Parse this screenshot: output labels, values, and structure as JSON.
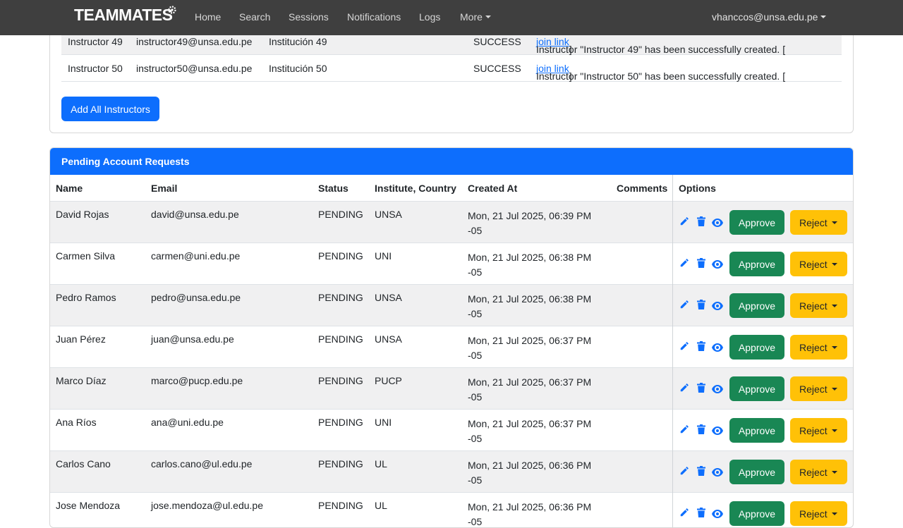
{
  "navbar": {
    "brand": "TEAMMATES",
    "links": [
      "Home",
      "Search",
      "Sessions",
      "Notifications",
      "Logs"
    ],
    "more_label": "More",
    "user_email": "vhanccos@unsa.edu.pe"
  },
  "instructors": {
    "rows": [
      {
        "name": "Instructor 49",
        "email": "instructor49@unsa.edu.pe",
        "institution": "Institución 49",
        "status": "SUCCESS",
        "message": "Instructor \"Instructor 49\" has been successfully created. [",
        "link": "join link",
        "message_end": "]"
      },
      {
        "name": "Instructor 50",
        "email": "instructor50@unsa.edu.pe",
        "institution": "Institución 50",
        "status": "SUCCESS",
        "message": "Instructor \"Instructor 50\" has been successfully created. [",
        "link": "join link",
        "message_end": "]"
      }
    ],
    "add_all_label": "Add All Instructors"
  },
  "pending": {
    "title": "Pending Account Requests",
    "columns": [
      "Name",
      "Email",
      "Status",
      "Institute, Country",
      "Created At",
      "Comments",
      "Options"
    ],
    "approve_label": "Approve",
    "reject_label": "Reject",
    "rows": [
      {
        "name": "David Rojas",
        "email": "david@unsa.edu.pe",
        "status": "PENDING",
        "institute": "UNSA",
        "created": "Mon, 21 Jul 2025, 06:39 PM -05",
        "comments": ""
      },
      {
        "name": "Carmen Silva",
        "email": "carmen@uni.edu.pe",
        "status": "PENDING",
        "institute": "UNI",
        "created": "Mon, 21 Jul 2025, 06:38 PM -05",
        "comments": ""
      },
      {
        "name": "Pedro Ramos",
        "email": "pedro@unsa.edu.pe",
        "status": "PENDING",
        "institute": "UNSA",
        "created": "Mon, 21 Jul 2025, 06:38 PM -05",
        "comments": ""
      },
      {
        "name": "Juan Pérez",
        "email": "juan@unsa.edu.pe",
        "status": "PENDING",
        "institute": "UNSA",
        "created": "Mon, 21 Jul 2025, 06:37 PM -05",
        "comments": ""
      },
      {
        "name": "Marco Díaz",
        "email": "marco@pucp.edu.pe",
        "status": "PENDING",
        "institute": "PUCP",
        "created": "Mon, 21 Jul 2025, 06:37 PM -05",
        "comments": ""
      },
      {
        "name": "Ana Ríos",
        "email": "ana@uni.edu.pe",
        "status": "PENDING",
        "institute": "UNI",
        "created": "Mon, 21 Jul 2025, 06:37 PM -05",
        "comments": ""
      },
      {
        "name": "Carlos Cano",
        "email": "carlos.cano@ul.edu.pe",
        "status": "PENDING",
        "institute": "UL",
        "created": "Mon, 21 Jul 2025, 06:36 PM -05",
        "comments": ""
      },
      {
        "name": "Jose Mendoza",
        "email": "jose.mendoza@ul.edu.pe",
        "status": "PENDING",
        "institute": "UL",
        "created": "Mon, 21 Jul 2025, 06:36 PM -05",
        "comments": ""
      }
    ]
  },
  "colors": {
    "navbar": "#3f3f3f",
    "primary": "#0d6efd",
    "success": "#198754",
    "warning": "#ffc107"
  },
  "icons": [
    "settings-gear-icon",
    "pencil-icon",
    "trash-icon",
    "eye-icon",
    "chevron-down-icon"
  ]
}
